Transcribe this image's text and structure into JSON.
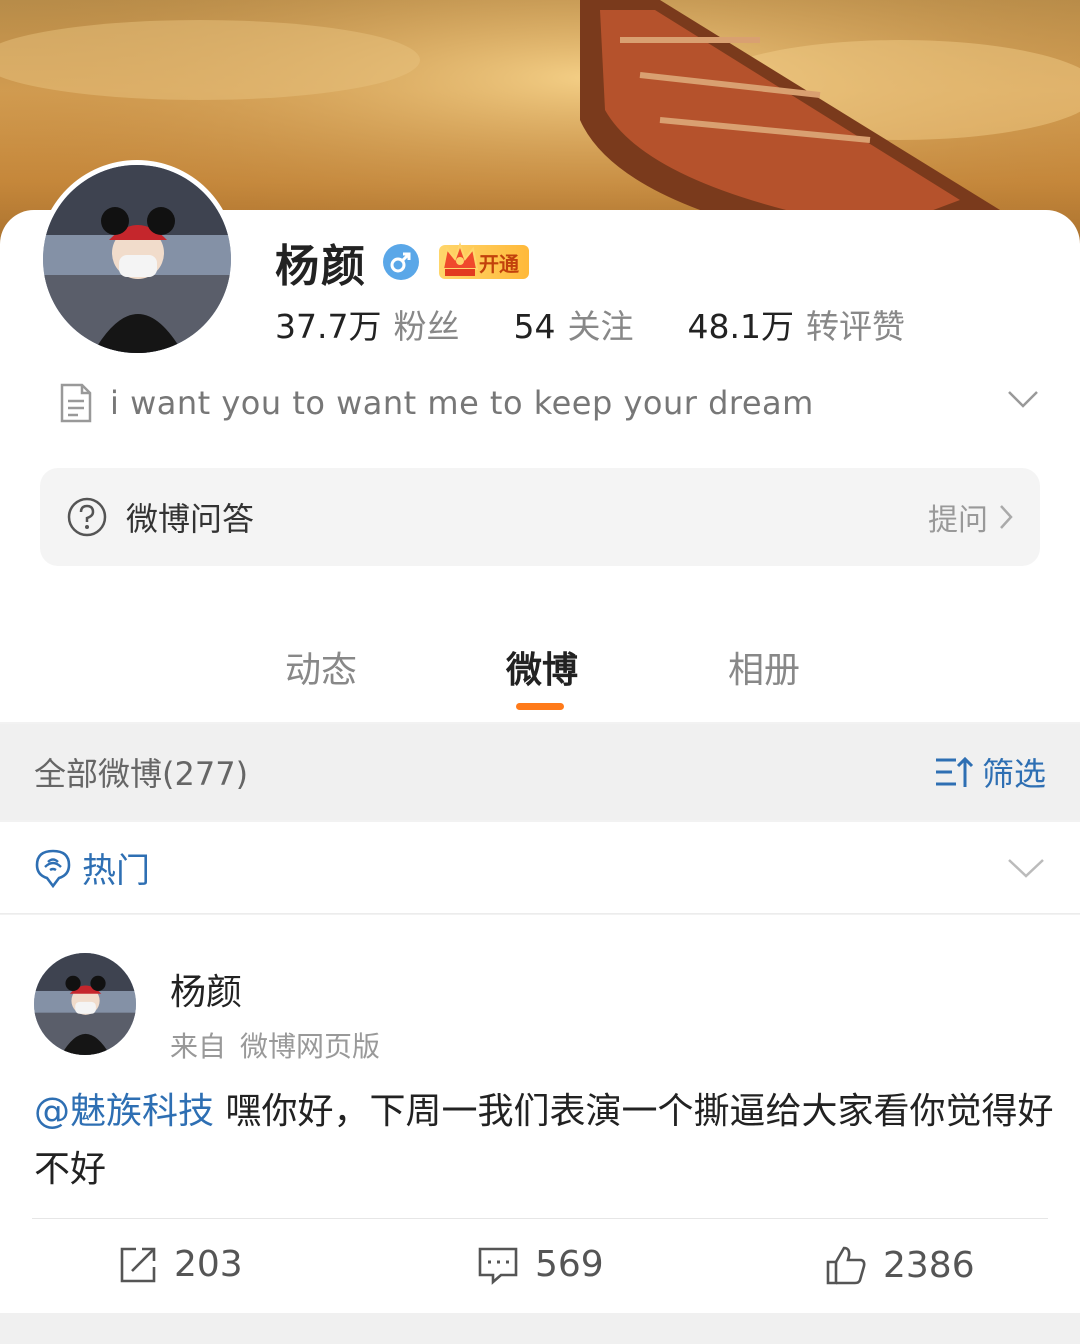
{
  "profile": {
    "name": "杨颜",
    "vip_label": "开通",
    "stats": [
      {
        "num": "37.7万",
        "label": "粉丝"
      },
      {
        "num": "54",
        "label": "关注"
      },
      {
        "num": "48.1万",
        "label": "转评赞"
      }
    ],
    "bio": "i want you to want me to keep your dream"
  },
  "qa": {
    "label": "微博问答",
    "ask": "提问"
  },
  "tabs": [
    {
      "label": "动态",
      "active": false
    },
    {
      "label": "微博",
      "active": true
    },
    {
      "label": "相册",
      "active": false
    }
  ],
  "feed": {
    "all_label": "全部微博(277)",
    "filter_label": "筛选",
    "hot_label": "热门"
  },
  "post": {
    "author": "杨颜",
    "source_prefix": "来自",
    "source": "微博网页版",
    "mention": "@魅族科技",
    "text": " 嘿你好，下周一我们表演一个撕逼给大家看你觉得好不好",
    "reposts": "203",
    "comments": "569",
    "likes": "2386"
  },
  "colors": {
    "accent": "#ff7a1a",
    "link": "#2e6fb3",
    "gender_badge": "#5aa7e8"
  },
  "icons": [
    "gender-male-icon",
    "vip-crown-icon",
    "document-icon",
    "chevron-down-icon",
    "question-circle-icon",
    "chevron-right-icon",
    "filter-sort-icon",
    "hot-pin-icon",
    "repost-icon",
    "comment-icon",
    "like-icon"
  ]
}
